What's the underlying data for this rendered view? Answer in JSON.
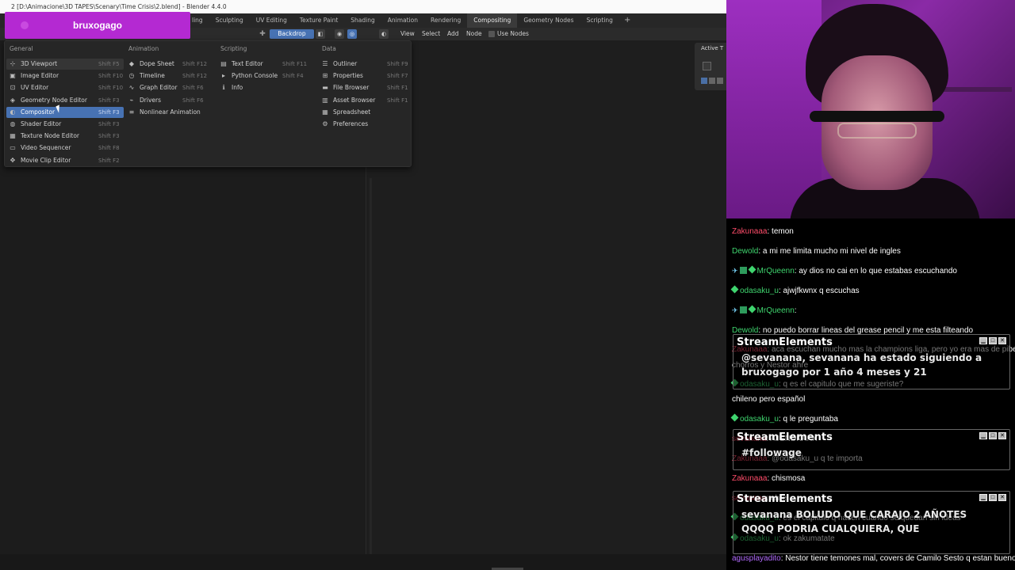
{
  "window": {
    "title": "2 [D:\\Animacione\\3D TAPES\\Scenary\\Time Crisis\\2.blend] - Blender 4.4.0"
  },
  "workspaces": [
    {
      "label": "ling",
      "active": false
    },
    {
      "label": "Sculpting",
      "active": false
    },
    {
      "label": "UV Editing",
      "active": false
    },
    {
      "label": "Texture Paint",
      "active": false
    },
    {
      "label": "Shading",
      "active": false
    },
    {
      "label": "Animation",
      "active": false
    },
    {
      "label": "Rendering",
      "active": false
    },
    {
      "label": "Compositing",
      "active": true
    },
    {
      "label": "Geometry Nodes",
      "active": false
    },
    {
      "label": "Scripting",
      "active": false
    }
  ],
  "workspace_add": "+",
  "header": {
    "backdrop_label": "Backdrop",
    "menus": [
      "View",
      "Select",
      "Add",
      "Node"
    ],
    "use_nodes_label": "Use Nodes"
  },
  "sidebar": {
    "active_label": "Active T"
  },
  "overlay": {
    "channel_name": "bruxogago"
  },
  "editor_menu": {
    "columns": [
      {
        "heading": "General",
        "items": [
          {
            "icon": "viewport-3d-icon",
            "glyph": "⊹",
            "label": "3D Viewport",
            "shortcut": "Shift F5",
            "state": "hover"
          },
          {
            "icon": "image-editor-icon",
            "glyph": "▣",
            "label": "Image Editor",
            "shortcut": "Shift F10",
            "state": ""
          },
          {
            "icon": "uv-editor-icon",
            "glyph": "⊡",
            "label": "UV Editor",
            "shortcut": "Shift F10",
            "state": ""
          },
          {
            "icon": "geometry-node-icon",
            "glyph": "◈",
            "label": "Geometry Node Editor",
            "shortcut": "Shift F3",
            "state": ""
          },
          {
            "icon": "compositor-icon",
            "glyph": "◐",
            "label": "Compositor",
            "shortcut": "Shift F3",
            "state": "highlight"
          },
          {
            "icon": "shader-editor-icon",
            "glyph": "◍",
            "label": "Shader Editor",
            "shortcut": "Shift F3",
            "state": ""
          },
          {
            "icon": "texture-node-icon",
            "glyph": "▦",
            "label": "Texture Node Editor",
            "shortcut": "Shift F3",
            "state": ""
          },
          {
            "icon": "video-sequencer-icon",
            "glyph": "▭",
            "label": "Video Sequencer",
            "shortcut": "Shift F8",
            "state": ""
          },
          {
            "icon": "movie-clip-icon",
            "glyph": "✥",
            "label": "Movie Clip Editor",
            "shortcut": "Shift F2",
            "state": ""
          }
        ]
      },
      {
        "heading": "Animation",
        "items": [
          {
            "icon": "dope-sheet-icon",
            "glyph": "◆",
            "label": "Dope Sheet",
            "shortcut": "Shift F12",
            "state": ""
          },
          {
            "icon": "timeline-icon",
            "glyph": "◷",
            "label": "Timeline",
            "shortcut": "Shift F12",
            "state": ""
          },
          {
            "icon": "graph-editor-icon",
            "glyph": "∿",
            "label": "Graph Editor",
            "shortcut": "Shift F6",
            "state": ""
          },
          {
            "icon": "drivers-icon",
            "glyph": "⌁",
            "label": "Drivers",
            "shortcut": "Shift F6",
            "state": ""
          },
          {
            "icon": "nla-icon",
            "glyph": "≡",
            "label": "Nonlinear Animation",
            "shortcut": "",
            "state": ""
          }
        ]
      },
      {
        "heading": "Scripting",
        "items": [
          {
            "icon": "text-editor-icon",
            "glyph": "▤",
            "label": "Text Editor",
            "shortcut": "Shift F11",
            "state": ""
          },
          {
            "icon": "python-console-icon",
            "glyph": "▸",
            "label": "Python Console",
            "shortcut": "Shift F4",
            "state": ""
          },
          {
            "icon": "info-icon",
            "glyph": "ℹ",
            "label": "Info",
            "shortcut": "",
            "state": ""
          }
        ]
      },
      {
        "heading": "Data",
        "items": [
          {
            "icon": "outliner-icon",
            "glyph": "☰",
            "label": "Outliner",
            "shortcut": "Shift F9",
            "state": ""
          },
          {
            "icon": "properties-icon",
            "glyph": "⊞",
            "label": "Properties",
            "shortcut": "Shift F7",
            "state": ""
          },
          {
            "icon": "file-browser-icon",
            "glyph": "▬",
            "label": "File Browser",
            "shortcut": "Shift F1",
            "state": ""
          },
          {
            "icon": "asset-browser-icon",
            "glyph": "▥",
            "label": "Asset Browser",
            "shortcut": "Shift F1",
            "state": ""
          },
          {
            "icon": "spreadsheet-icon",
            "glyph": "▦",
            "label": "Spreadsheet",
            "shortcut": "",
            "state": ""
          },
          {
            "icon": "preferences-icon",
            "glyph": "⚙",
            "label": "Preferences",
            "shortcut": "",
            "state": ""
          }
        ]
      }
    ]
  },
  "chat": {
    "messages": [
      {
        "user": "Zakunaaa",
        "color": "#ff4d6a",
        "badges": [],
        "text": ": temon"
      },
      {
        "user": "Dewold",
        "color": "#3fd46e",
        "badges": [],
        "text": ": a mi me limita mucho mi nivel de ingles"
      },
      {
        "user": "MrQueenn",
        "color": "#3fd46e",
        "badges": [
          "pin",
          "box",
          "diamond"
        ],
        "text": ": ay dios no cai en lo que estabas escuchando"
      },
      {
        "user": "odasaku_u",
        "color": "#3fd46e",
        "badges": [
          "diamond"
        ],
        "text": ": ajwjfkwnx q escuchas"
      },
      {
        "user": "MrQueenn",
        "color": "#3fd46e",
        "badges": [
          "pin",
          "box",
          "diamond"
        ],
        "text": ":"
      },
      {
        "user": "Dewold",
        "color": "#3fd46e",
        "badges": [],
        "text": ": no puedo borrar lineas del grease pencil y me esta filteando"
      },
      {
        "user": "Zakunaaa",
        "color": "#ff4d6a",
        "badges": [],
        "text": ": aca escuchan mucho mas la champions liga, pero yo era mas de pibes"
      },
      {
        "user": "",
        "color": "#fff",
        "badges": [],
        "text": "chorros y Nestor ahre"
      },
      {
        "user": "odasaku_u",
        "color": "#3fd46e",
        "badges": [
          "diamond"
        ],
        "text": ": q es el capitulo que me sugeriste?"
      },
      {
        "user": "",
        "color": "#fff",
        "badges": [],
        "text": "chileno pero español"
      },
      {
        "user": "odasaku_u",
        "color": "#3fd46e",
        "badges": [
          "diamond"
        ],
        "text": ": q le preguntaba"
      },
      {
        "user": "sevanana",
        "color": "#ff4d6a",
        "badges": [],
        "text": ": AJSNDKAKX"
      },
      {
        "user": "Zakunaaa",
        "color": "#ff4d6a",
        "badges": [],
        "text": ": @odasaku_u q te importa"
      },
      {
        "user": "Zakunaaa",
        "color": "#ff4d6a",
        "badges": [],
        "text": ": chismosa"
      },
      {
        "user": "sevanana",
        "color": "#ff4d6a",
        "badges": [],
        "text": ": ahre"
      },
      {
        "user": "odasaku_u",
        "color": "#3fd46e",
        "badges": [
          "diamond"
        ],
        "text": ": es el capitulo q hacen cuando se quedan sin ideas"
      },
      {
        "user": "odasaku_u",
        "color": "#3fd46e",
        "badges": [
          "diamond"
        ],
        "text": ": ok zakumatate"
      },
      {
        "user": "agusplayadito",
        "color": "#b36bff",
        "badges": [],
        "text": ": Nestor tiene temones mal, covers de Camilo Sesto q estan buenos"
      }
    ]
  },
  "stream_elements": [
    {
      "title": "StreamElements",
      "text": "@sevanana, sevanana ha estado siguiendo a",
      "text2": "bruxogago por 1 año 4 meses y 21"
    },
    {
      "title": "StreamElements",
      "text": "#followage",
      "text2": ""
    },
    {
      "title": "StreamElements",
      "text": "sevanana BOLUDO QUE CARAJO 2 AÑOTES",
      "text2": "QQQQ PODRIA CUALQUIERA, QUE"
    }
  ],
  "colors": {
    "accent": "#4772b3",
    "badge": "#b429d2"
  }
}
